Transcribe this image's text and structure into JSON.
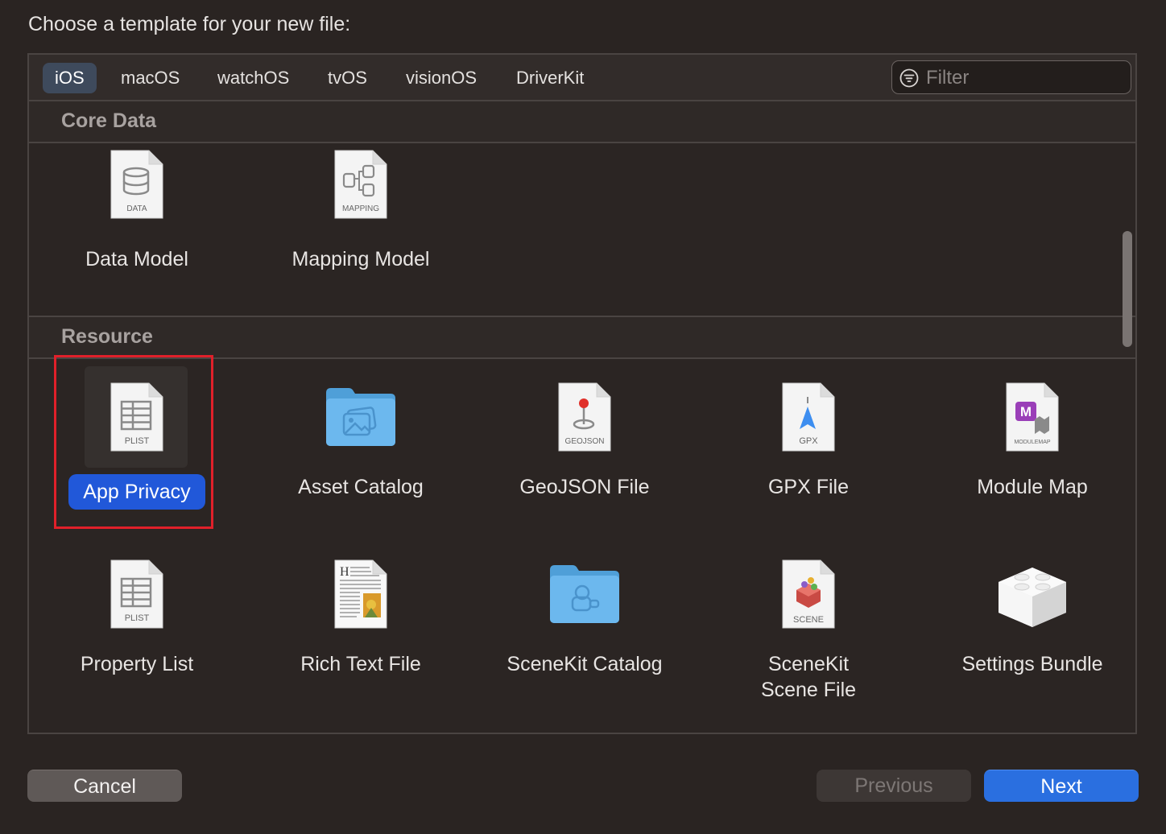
{
  "dialog": {
    "title": "Choose a template for your new file:"
  },
  "tabs": [
    {
      "label": "iOS",
      "active": true
    },
    {
      "label": "macOS"
    },
    {
      "label": "watchOS"
    },
    {
      "label": "tvOS"
    },
    {
      "label": "visionOS"
    },
    {
      "label": "DriverKit"
    }
  ],
  "filter": {
    "placeholder": "Filter",
    "value": ""
  },
  "sections": [
    {
      "title": "Core Data",
      "items": [
        {
          "label": "Data Model",
          "icon": "data-model-icon",
          "badge": "DATA"
        },
        {
          "label": "Mapping Model",
          "icon": "mapping-model-icon",
          "badge": "MAPPING"
        }
      ]
    },
    {
      "title": "Resource",
      "items": [
        {
          "label": "App Privacy",
          "icon": "plist-icon",
          "badge": "PLIST",
          "selected": true
        },
        {
          "label": "Asset Catalog",
          "icon": "asset-folder-icon"
        },
        {
          "label": "GeoJSON File",
          "icon": "geojson-icon",
          "badge": "GEOJSON"
        },
        {
          "label": "GPX File",
          "icon": "gpx-icon",
          "badge": "GPX"
        },
        {
          "label": "Module Map",
          "icon": "modulemap-icon",
          "badge": "MODULEMAP"
        },
        {
          "label": "Property List",
          "icon": "plist-icon",
          "badge": "PLIST"
        },
        {
          "label": "Rich Text File",
          "icon": "rich-text-icon"
        },
        {
          "label": "SceneKit Catalog",
          "icon": "scenekit-folder-icon"
        },
        {
          "label": "SceneKit",
          "label2": "Scene File",
          "icon": "scene-file-icon",
          "badge": "SCENE"
        },
        {
          "label": "Settings Bundle",
          "icon": "lego-brick-icon"
        }
      ]
    }
  ],
  "buttons": {
    "cancel": "Cancel",
    "previous": "Previous",
    "next": "Next"
  },
  "colors": {
    "accent": "#2a6fe0",
    "selection": "#2158d9",
    "highlight_box": "#e0202a"
  }
}
